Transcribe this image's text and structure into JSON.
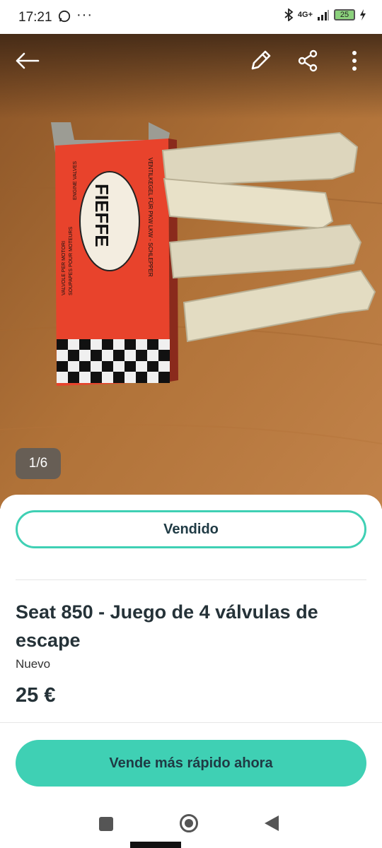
{
  "status_bar": {
    "time": "17:21",
    "network": "4G+",
    "battery": "25",
    "notification_icons": [
      "whatsapp-icon",
      "more-dots-icon"
    ],
    "right_icons": [
      "bluetooth-icon",
      "signal-icon",
      "battery-icon",
      "charging-icon"
    ]
  },
  "header": {
    "back_icon": "arrow-left-icon",
    "edit_icon": "pencil-icon",
    "share_icon": "share-icon",
    "menu_icon": "kebab-menu-icon"
  },
  "gallery": {
    "counter": "1/6",
    "photo_text": {
      "brand": "FIEFFE",
      "line1": "VENTILKEGEL FÜR PKW LKW - SCHLEPPER",
      "line2": "ENGINE VALVES",
      "line3": "VALVOLE PER MOTORI",
      "line4": "SOUPAPES POUR MOTEURS"
    }
  },
  "listing": {
    "status_button": "Vendido",
    "title": "Seat 850 - Juego de 4 válvulas de escape",
    "condition": "Nuevo",
    "price": "25 €",
    "cta": "Vende más rápido ahora"
  },
  "colors": {
    "accent": "#3fd0b4",
    "text_dark": "#253238",
    "box_red": "#e8432c"
  },
  "nav_bar": {
    "icons": [
      "recent-apps-icon",
      "home-icon",
      "back-icon"
    ]
  }
}
